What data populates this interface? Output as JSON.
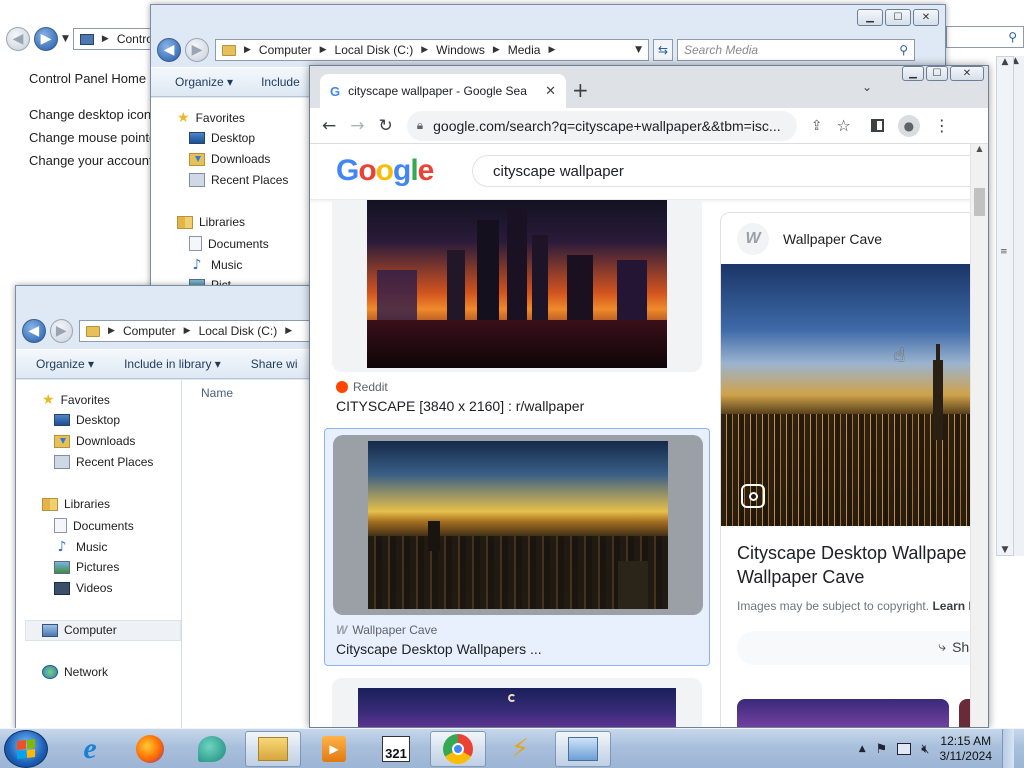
{
  "control_panel": {
    "address": "Control",
    "links": [
      "Control Panel Home",
      "Change desktop icons",
      "Change mouse pointer",
      "Change your account p"
    ]
  },
  "media_explorer": {
    "breadcrumb": [
      "Computer",
      "Local Disk (C:)",
      "Windows",
      "Media"
    ],
    "search_placeholder": "Search Media",
    "toolbar": [
      "Organize ▾",
      "Include"
    ],
    "nav": {
      "favorites": "Favorites",
      "desktop": "Desktop",
      "downloads": "Downloads",
      "recent": "Recent Places",
      "libraries": "Libraries",
      "documents": "Documents",
      "music": "Music",
      "pictures_cut": "Pict"
    }
  },
  "c_explorer": {
    "breadcrumb": [
      "Computer",
      "Local Disk (C:)"
    ],
    "toolbar": {
      "organize": "Organize ▾",
      "include": "Include in library ▾",
      "share": "Share wi"
    },
    "column_name": "Name",
    "nav": {
      "favorites": "Favorites",
      "desktop": "Desktop",
      "downloads": "Downloads",
      "recent": "Recent Places",
      "libraries": "Libraries",
      "documents": "Documents",
      "music": "Music",
      "pictures": "Pictures",
      "videos": "Videos",
      "computer": "Computer",
      "network": "Network"
    }
  },
  "browser": {
    "tab_title": "cityscape wallpaper - Google Sea",
    "url": "google.com/search?q=cityscape+wallpaper&&tbm=isc...",
    "search_query": "cityscape wallpaper",
    "logo": "Google",
    "results": [
      {
        "source": "Reddit",
        "title": "CITYSCAPE [3840 x 2160] : r/wallpaper"
      },
      {
        "source": "Wallpaper Cave",
        "title": "Cityscape Desktop Wallpapers ..."
      }
    ],
    "side_panel": {
      "source": "Wallpaper Cave",
      "title_line1": "Cityscape Desktop Wallpape",
      "title_line2": "Wallpaper Cave",
      "copyright": "Images may be subject to copyright.",
      "learn": "Learn I",
      "share": "Sha"
    }
  },
  "taskbar": {
    "time": "12:15 AM",
    "date": "3/11/2024"
  }
}
